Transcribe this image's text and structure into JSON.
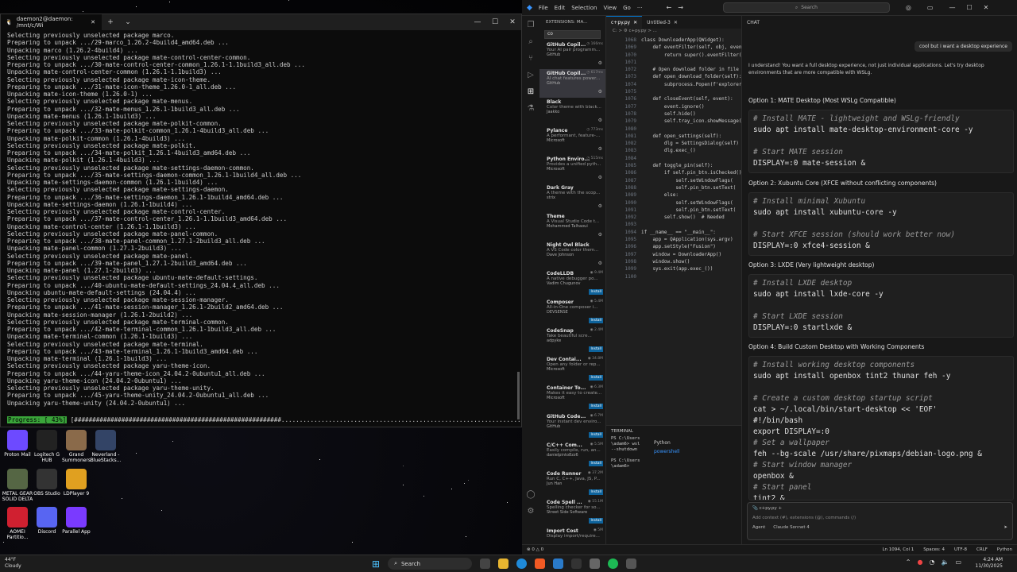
{
  "desktop": {
    "icons": [
      {
        "label": "Proton Mail",
        "color": "#6d4aff"
      },
      {
        "label": "Logitech G HUB",
        "color": "#222"
      },
      {
        "label": "Grand Summoners",
        "color": "#8a6a4a"
      },
      {
        "label": "Neverland - BlueStacks...",
        "color": "#334466"
      },
      {
        "label": "METAL GEAR SOLID DELTA",
        "color": "#556644"
      },
      {
        "label": "OBS Studio",
        "color": "#333"
      },
      {
        "label": "LDPlayer 9",
        "color": "#e0a020"
      },
      {
        "label": "AOMEI Partitio...",
        "color": "#d02030"
      },
      {
        "label": "Discord",
        "color": "#5865f2"
      },
      {
        "label": "Parallel App",
        "color": "#7a3aff"
      }
    ]
  },
  "terminal": {
    "tab_title": "daemon2@daemon: /mnt/c/Wi",
    "new_tab": "+",
    "dropdown": "⌄",
    "lines": [
      "Selecting previously unselected package marco.",
      "Preparing to unpack .../29-marco_1.26.2-4build4_amd64.deb ...",
      "Unpacking marco (1.26.2-4build4) ...",
      "Selecting previously unselected package mate-control-center-common.",
      "Preparing to unpack .../30-mate-control-center-common_1.26.1-1.1build3_all.deb ...",
      "Unpacking mate-control-center-common (1.26.1-1.1build3) ...",
      "Selecting previously unselected package mate-icon-theme.",
      "Preparing to unpack .../31-mate-icon-theme_1.26.0-1_all.deb ...",
      "Unpacking mate-icon-theme (1.26.0-1) ...",
      "Selecting previously unselected package mate-menus.",
      "Preparing to unpack .../32-mate-menus_1.26.1-1build3_all.deb ...",
      "Unpacking mate-menus (1.26.1-1build3) ...",
      "Selecting previously unselected package mate-polkit-common.",
      "Preparing to unpack .../33-mate-polkit-common_1.26.1-4build3_all.deb ...",
      "Unpacking mate-polkit-common (1.26.1-4build3) ...",
      "Selecting previously unselected package mate-polkit.",
      "Preparing to unpack .../34-mate-polkit_1.26.1-4build3_amd64.deb ...",
      "Unpacking mate-polkit (1.26.1-4build3) ...",
      "Selecting previously unselected package mate-settings-daemon-common.",
      "Preparing to unpack .../35-mate-settings-daemon-common_1.26.1-1build4_all.deb ...",
      "Unpacking mate-settings-daemon-common (1.26.1-1build4) ...",
      "Selecting previously unselected package mate-settings-daemon.",
      "Preparing to unpack .../36-mate-settings-daemon_1.26.1-1build4_amd64.deb ...",
      "Unpacking mate-settings-daemon (1.26.1-1build4) ...",
      "Selecting previously unselected package mate-control-center.",
      "Preparing to unpack .../37-mate-control-center_1.26.1-1.1build3_amd64.deb ...",
      "Unpacking mate-control-center (1.26.1-1.1build3) ...",
      "Selecting previously unselected package mate-panel-common.",
      "Preparing to unpack .../38-mate-panel-common_1.27.1-2build3_all.deb ...",
      "Unpacking mate-panel-common (1.27.1-2build3) ...",
      "Selecting previously unselected package mate-panel.",
      "Preparing to unpack .../39-mate-panel_1.27.1-2build3_amd64.deb ...",
      "Unpacking mate-panel (1.27.1-2build3) ...",
      "Selecting previously unselected package ubuntu-mate-default-settings.",
      "Preparing to unpack .../40-ubuntu-mate-default-settings_24.04.4_all.deb ...",
      "Unpacking ubuntu-mate-default-settings (24.04.4) ...",
      "Selecting previously unselected package mate-session-manager.",
      "Preparing to unpack .../41-mate-session-manager_1.26.1-2build2_amd64.deb ...",
      "Unpacking mate-session-manager (1.26.1-2build2) ...",
      "Selecting previously unselected package mate-terminal-common.",
      "Preparing to unpack .../42-mate-terminal-common_1.26.1-1build3_all.deb ...",
      "Unpacking mate-terminal-common (1.26.1-1build3) ...",
      "Selecting previously unselected package mate-terminal.",
      "Preparing to unpack .../43-mate-terminal_1.26.1-1build3_amd64.deb ...",
      "Unpacking mate-terminal (1.26.1-1build3) ...",
      "Selecting previously unselected package yaru-theme-icon.",
      "Preparing to unpack .../44-yaru-theme-icon_24.04.2-0ubuntu1_all.deb ...",
      "Unpacking yaru-theme-icon (24.04.2-0ubuntu1) ...",
      "Selecting previously unselected package yaru-theme-unity.",
      "Preparing to unpack .../45-yaru-theme-unity_24.04.2-0ubuntu1_all.deb ...",
      "Unpacking yaru-theme-unity (24.04.2-0ubuntu1) ..."
    ],
    "progress_label": "Progress: [ 43%]",
    "progress_bar": " [#########################################################.............................................................................]",
    "progress_fraction": 0.43
  },
  "vscode": {
    "menu": [
      "File",
      "Edit",
      "Selection",
      "View",
      "Go",
      "···"
    ],
    "search_placeholder": "Search",
    "extensions_header": "EXTENSIONS: MA...",
    "extensions_search": "co",
    "extensions": [
      {
        "name": "GitHub Copil...",
        "desc": "Your AI pair programm...",
        "pub": "GitHub",
        "meta": "◷ 166ms",
        "installed": true,
        "selected": false
      },
      {
        "name": "GitHub Copil...",
        "desc": "AI chat features power...",
        "pub": "GitHub",
        "meta": "◷ 617ms",
        "installed": true,
        "selected": true
      },
      {
        "name": "Black",
        "desc": "Color theme with black...",
        "pub": "Jaakko",
        "meta": "",
        "installed": true,
        "selected": false
      },
      {
        "name": "Pylance",
        "desc": "A performant, feature-...",
        "pub": "Microsoft",
        "meta": "◷ 773ms",
        "installed": true,
        "selected": false
      },
      {
        "name": "Python Enviro...",
        "desc": "Provides a unified pyth...",
        "pub": "Microsoft",
        "meta": "◷ 515ms",
        "installed": true,
        "selected": false
      },
      {
        "name": "Dark Gray",
        "desc": "A theme with the scop...",
        "pub": "strix",
        "meta": "",
        "installed": true,
        "selected": false
      },
      {
        "name": "Theme",
        "desc": "A Visual Studio Code t...",
        "pub": "Mohammed Talhaoui",
        "meta": "",
        "installed": true,
        "selected": false
      },
      {
        "name": "Night Owl Black",
        "desc": "A VS Code color them...",
        "pub": "Dave Johnson",
        "meta": "",
        "installed": true,
        "selected": false
      },
      {
        "name": "CodeLLDB",
        "desc": "A native debugger po...",
        "pub": "Vadim Chugunov",
        "meta": "◉ 9.4M",
        "installed": false,
        "selected": false
      },
      {
        "name": "Composer",
        "desc": "All-in-One composer i...",
        "pub": "DEVSENSE",
        "meta": "◉ 5.4M",
        "installed": false,
        "selected": false
      },
      {
        "name": "CodeSnap",
        "desc": "Take beautiful scre...",
        "pub": "adpyke",
        "meta": "◉ 2.4M",
        "installed": false,
        "selected": false
      },
      {
        "name": "Dev Contai...",
        "desc": "Open any folder or rep...",
        "pub": "Microsoft",
        "meta": "◉ 34.8M",
        "installed": false,
        "selected": false
      },
      {
        "name": "Container To...",
        "desc": "Makes it easy to create...",
        "pub": "Microsoft",
        "meta": "◉ 6.3M",
        "installed": false,
        "selected": false
      },
      {
        "name": "GitHub Code...",
        "desc": "Your instant dev enviro...",
        "pub": "GitHub",
        "meta": "◉ 6.7M",
        "installed": false,
        "selected": false
      },
      {
        "name": "C/C++ Com...",
        "desc": "Easily compile, run, an...",
        "pub": "danielpinto8zz6",
        "meta": "◉ 5.5M",
        "installed": false,
        "selected": false
      },
      {
        "name": "Code Runner",
        "desc": "Run C, C++, Java, JS, P...",
        "pub": "Jun Han",
        "meta": "◉ 37.2M",
        "installed": false,
        "selected": false
      },
      {
        "name": "Code Spell ...",
        "desc": "Spelling checker for so...",
        "pub": "Street Side Software",
        "meta": "◉ 15.1M",
        "installed": false,
        "selected": false
      },
      {
        "name": "Import Cost",
        "desc": "Display import/require...",
        "pub": "",
        "meta": "◉ 5M",
        "installed": false,
        "selected": false
      }
    ],
    "install_label": "Install",
    "tabs": [
      "c+py.py",
      "Untitled-3"
    ],
    "breadcrumb": "C: > ⚙ c+py.py > ...",
    "code_lines": [
      {
        "n": "1068",
        "t": "class DownloaderApp(QWidget):"
      },
      {
        "n": "1069",
        "t": "    def eventFilter(self, obj, event):"
      },
      {
        "n": "1070",
        "t": "        return super().eventFilter(obj, event)"
      },
      {
        "n": "1071",
        "t": ""
      },
      {
        "n": "1072",
        "t": "    # Open download folder in file explorer"
      },
      {
        "n": "1073",
        "t": "    def open_download_folder(self):"
      },
      {
        "n": "1074",
        "t": "        subprocess.Popen(f'explorer \"{self.output_dir}\"')"
      },
      {
        "n": "1075",
        "t": ""
      },
      {
        "n": "1076",
        "t": "    def closeEvent(self, event):"
      },
      {
        "n": "1077",
        "t": "        event.ignore()"
      },
      {
        "n": "1078",
        "t": "        self.hide()"
      },
      {
        "n": "1079",
        "t": "        self.tray_icon.showMessage("
      },
      {
        "n": "1080",
        "t": ""
      },
      {
        "n": "1081",
        "t": "    def open_settings(self):"
      },
      {
        "n": "1082",
        "t": "        dlg = SettingsDialog(self)"
      },
      {
        "n": "1083",
        "t": "        dlg.exec_()"
      },
      {
        "n": "1084",
        "t": ""
      },
      {
        "n": "1085",
        "t": "    def toggle_pin(self):"
      },
      {
        "n": "1086",
        "t": "        if self.pin_btn.isChecked():"
      },
      {
        "n": "1087",
        "t": "            self.setWindowFlags("
      },
      {
        "n": "1088",
        "t": "            self.pin_btn.setText("
      },
      {
        "n": "1089",
        "t": "        else:"
      },
      {
        "n": "1090",
        "t": "            self.setWindowFlags("
      },
      {
        "n": "1091",
        "t": "            self.pin_btn.setText("
      },
      {
        "n": "1092",
        "t": "        self.show()  # Needed"
      },
      {
        "n": "1093",
        "t": ""
      },
      {
        "n": "1094",
        "t": "if __name__ == \"__main__\":"
      },
      {
        "n": "1095",
        "t": "    app = QApplication(sys.argv)"
      },
      {
        "n": "1096",
        "t": "    app.setStyle(\"Fusion\")"
      },
      {
        "n": "1097",
        "t": "    window = DownloaderApp()"
      },
      {
        "n": "1098",
        "t": "    window.show()"
      },
      {
        "n": "1099",
        "t": "    sys.exit(app.exec_())"
      },
      {
        "n": "1100",
        "t": ""
      }
    ],
    "terminal_header": "TERMINAL",
    "terminal_output": "PS C:\\Users\n\\adam6> wsl\n--shutdown\n\nPS C:\\Users\n\\adam6>",
    "shells": [
      "Python",
      "powershell"
    ],
    "chat": {
      "header": "CHAT",
      "user_message": "cool but i want a desktop experience",
      "intro": "I understand! You want a full desktop experience, not just individual applications. Let's try desktop environments that are more compatible with WSLg.",
      "options": [
        {
          "title": "Option 1: MATE Desktop (Most WSLg Compatible)",
          "code": [
            {
              "c": true,
              "t": "# Install MATE - lightweight and WSLg-friendly"
            },
            {
              "c": false,
              "t": "sudo apt install mate-desktop-environment-core -y"
            },
            {
              "c": false,
              "t": ""
            },
            {
              "c": true,
              "t": "# Start MATE session"
            },
            {
              "c": false,
              "t": "DISPLAY=:0 mate-session &"
            }
          ]
        },
        {
          "title": "Option 2: Xubuntu Core (XFCE without conflicting components)",
          "code": [
            {
              "c": true,
              "t": "# Install minimal Xubuntu"
            },
            {
              "c": false,
              "t": "sudo apt install xubuntu-core -y"
            },
            {
              "c": false,
              "t": ""
            },
            {
              "c": true,
              "t": "# Start XFCE session (should work better now)"
            },
            {
              "c": false,
              "t": "DISPLAY=:0 xfce4-session &"
            }
          ]
        },
        {
          "title": "Option 3: LXDE (Very lightweight desktop)",
          "code": [
            {
              "c": true,
              "t": "# Install LXDE desktop"
            },
            {
              "c": false,
              "t": "sudo apt install lxde-core -y"
            },
            {
              "c": false,
              "t": ""
            },
            {
              "c": true,
              "t": "# Start LXDE session"
            },
            {
              "c": false,
              "t": "DISPLAY=:0 startlxde &"
            }
          ]
        },
        {
          "title": "Option 4: Build Custom Desktop with Working Components",
          "code": [
            {
              "c": true,
              "t": "# Install working desktop components"
            },
            {
              "c": false,
              "t": "sudo apt install openbox tint2 thunar feh -y"
            },
            {
              "c": false,
              "t": ""
            },
            {
              "c": true,
              "t": "# Create a custom desktop startup script"
            },
            {
              "c": false,
              "t": "cat > ~/.local/bin/start-desktop << 'EOF'"
            },
            {
              "c": false,
              "t": "#!/bin/bash"
            },
            {
              "c": false,
              "t": "export DISPLAY=:0"
            },
            {
              "c": true,
              "t": "# Set a wallpaper"
            },
            {
              "c": false,
              "t": "feh --bg-scale /usr/share/pixmaps/debian-logo.png &"
            },
            {
              "c": true,
              "t": "# Start window manager"
            },
            {
              "c": false,
              "t": "openbox &"
            },
            {
              "c": true,
              "t": "# Start panel"
            },
            {
              "c": false,
              "t": "tint2 &"
            },
            {
              "c": true,
              "t": "# Start file manager"
            }
          ]
        }
      ],
      "input_file": "c+py.py",
      "input_placeholder": "Add context (#), extensions (@), commands (/)",
      "mode": "Agent",
      "model": "Claude Sonnet 4"
    },
    "status": {
      "left": "⊗ 0 △ 0",
      "position": "Ln 1094, Col 1",
      "spaces": "Spaces: 4",
      "encoding": "UTF-8",
      "eol": "CRLF",
      "language": "Python"
    }
  },
  "taskbar": {
    "weather_temp": "44°F",
    "weather_desc": "Cloudy",
    "search": "Search",
    "time": "4:24 AM",
    "date": "11/30/2025"
  }
}
